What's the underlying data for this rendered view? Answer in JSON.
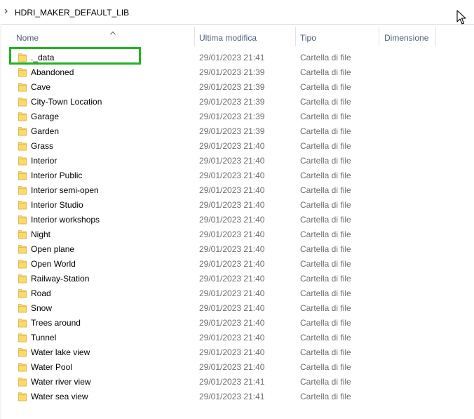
{
  "breadcrumb": {
    "path": "HDRI_MAKER_DEFAULT_LIB"
  },
  "columns": {
    "name": "Nome",
    "modified": "Ultima modifica",
    "type": "Tipo",
    "size": "Dimensione"
  },
  "sort": {
    "column": "name",
    "direction": "ascending"
  },
  "colors": {
    "highlight": "#22b322",
    "folder": "#f8d775",
    "header_text": "#4c607a"
  },
  "rows": [
    {
      "name": "._data",
      "modified": "29/01/2023 21:41",
      "type": "Cartella di file",
      "highlighted": true
    },
    {
      "name": "Abandoned",
      "modified": "29/01/2023 21:39",
      "type": "Cartella di file"
    },
    {
      "name": "Cave",
      "modified": "29/01/2023 21:39",
      "type": "Cartella di file"
    },
    {
      "name": "City-Town Location",
      "modified": "29/01/2023 21:39",
      "type": "Cartella di file"
    },
    {
      "name": "Garage",
      "modified": "29/01/2023 21:39",
      "type": "Cartella di file"
    },
    {
      "name": "Garden",
      "modified": "29/01/2023 21:39",
      "type": "Cartella di file"
    },
    {
      "name": "Grass",
      "modified": "29/01/2023 21:40",
      "type": "Cartella di file"
    },
    {
      "name": "Interior",
      "modified": "29/01/2023 21:40",
      "type": "Cartella di file"
    },
    {
      "name": "Interior Public",
      "modified": "29/01/2023 21:40",
      "type": "Cartella di file"
    },
    {
      "name": "Interior semi-open",
      "modified": "29/01/2023 21:40",
      "type": "Cartella di file"
    },
    {
      "name": "Interior Studio",
      "modified": "29/01/2023 21:40",
      "type": "Cartella di file"
    },
    {
      "name": "Interior workshops",
      "modified": "29/01/2023 21:40",
      "type": "Cartella di file"
    },
    {
      "name": "Night",
      "modified": "29/01/2023 21:40",
      "type": "Cartella di file"
    },
    {
      "name": "Open plane",
      "modified": "29/01/2023 21:40",
      "type": "Cartella di file"
    },
    {
      "name": "Open World",
      "modified": "29/01/2023 21:40",
      "type": "Cartella di file"
    },
    {
      "name": "Railway-Station",
      "modified": "29/01/2023 21:40",
      "type": "Cartella di file"
    },
    {
      "name": "Road",
      "modified": "29/01/2023 21:40",
      "type": "Cartella di file"
    },
    {
      "name": "Snow",
      "modified": "29/01/2023 21:40",
      "type": "Cartella di file"
    },
    {
      "name": "Trees around",
      "modified": "29/01/2023 21:40",
      "type": "Cartella di file"
    },
    {
      "name": "Tunnel",
      "modified": "29/01/2023 21:40",
      "type": "Cartella di file"
    },
    {
      "name": "Water lake view",
      "modified": "29/01/2023 21:40",
      "type": "Cartella di file"
    },
    {
      "name": "Water Pool",
      "modified": "29/01/2023 21:40",
      "type": "Cartella di file"
    },
    {
      "name": "Water river view",
      "modified": "29/01/2023 21:41",
      "type": "Cartella di file"
    },
    {
      "name": "Water sea view",
      "modified": "29/01/2023 21:41",
      "type": "Cartella di file"
    }
  ]
}
